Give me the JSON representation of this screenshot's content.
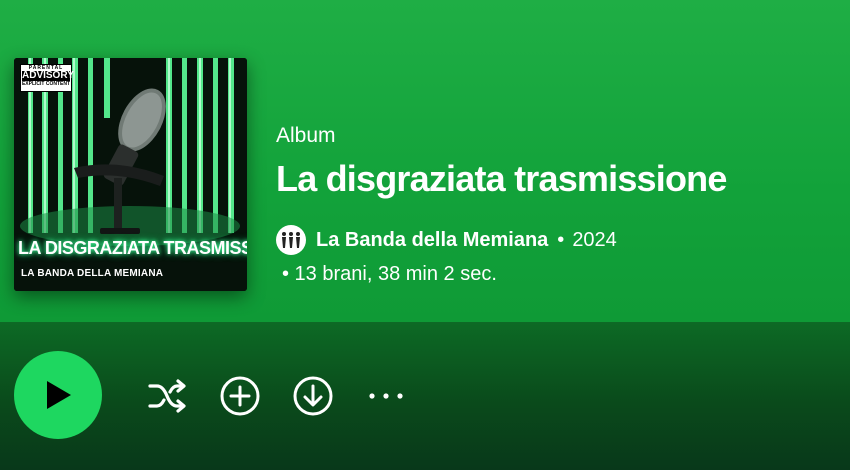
{
  "album": {
    "type_label": "Album",
    "title": "La disgraziata trasmissione",
    "artist": "La Banda della Memiana",
    "separator": "•",
    "year": "2024",
    "meta": "• 13 brani, 38 min 2 sec."
  },
  "cover": {
    "advisory_top": "PARENTAL",
    "advisory_main": "ADVISORY",
    "advisory_bottom": "EXPLICIT CONTENT",
    "title": "LA DISGRAZIATA TRASMISSIONE",
    "artist": "LA BANDA DELLA MEMIANA"
  },
  "actions": {
    "icons": [
      "play-icon",
      "shuffle-icon",
      "add-icon",
      "download-icon",
      "more-icon"
    ]
  },
  "colors": {
    "hero_green": "#1fae45",
    "play_button": "#1ed760",
    "dark_green": "#0a4a1b"
  }
}
